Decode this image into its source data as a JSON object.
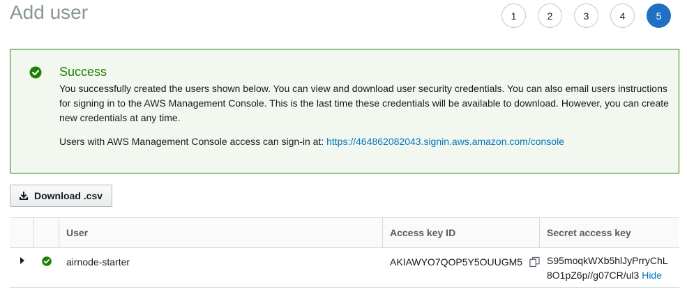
{
  "page": {
    "title": "Add user"
  },
  "steps": [
    "1",
    "2",
    "3",
    "4",
    "5"
  ],
  "active_step": "5",
  "alert": {
    "title": "Success",
    "body": "You successfully created the users shown below. You can view and download user security credentials. You can also email users instructions for signing in to the AWS Management Console. This is the last time these credentials will be available to download. However, you can create new credentials at any time.",
    "signin_prefix": "Users with AWS Management Console access can sign-in at: ",
    "signin_link": "https://464862082043.signin.aws.amazon.com/console",
    "color": "#1d8102"
  },
  "download_button": {
    "label": "Download .csv"
  },
  "table": {
    "columns": [
      "User",
      "Access key ID",
      "Secret access key"
    ],
    "rows": [
      {
        "user": "airnode-starter",
        "access_key_id": "AKIAWYO7QOP5Y5OUUGM5",
        "secret_line1": "S95moqkWXb5hlJyPrryChL",
        "secret_line2": "8O1pZ6p//g07CR/ul3",
        "hide_label": "Hide"
      }
    ]
  },
  "icons": {
    "success": "check-circle-icon",
    "download": "download-icon",
    "expand": "caret-right-icon",
    "copy": "copy-icon"
  },
  "colors": {
    "accent": "#1f6fc5",
    "link": "#0073bb",
    "success": "#1d8102"
  }
}
